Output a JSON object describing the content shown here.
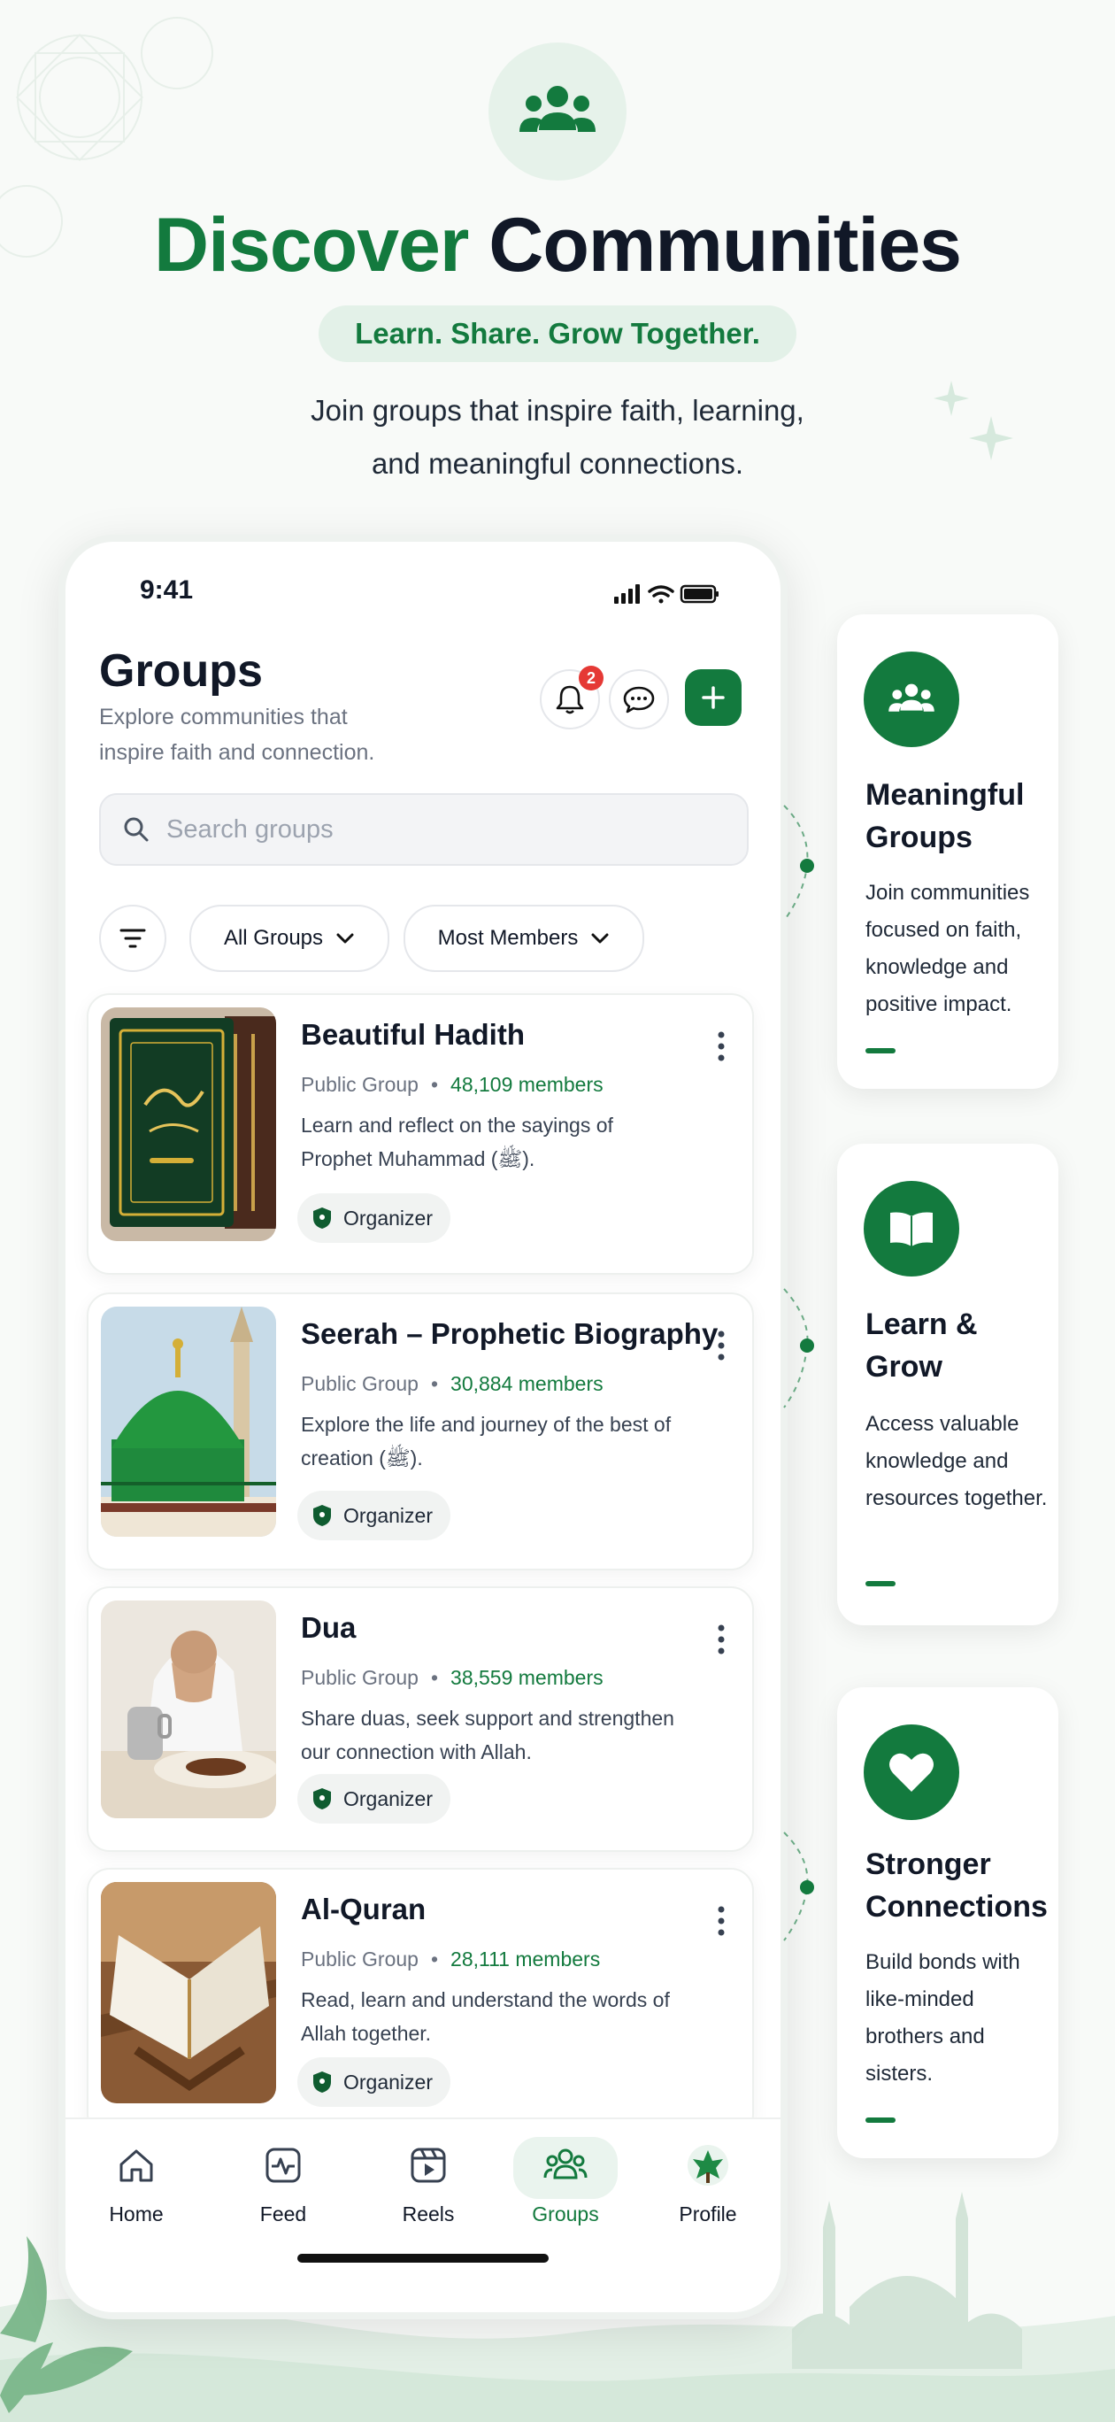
{
  "hero": {
    "title_green": "Discover",
    "title_dark": "Communities",
    "tagline": "Learn. Share. Grow Together.",
    "subtitle_line1": "Join groups that inspire faith, learning,",
    "subtitle_line2": "and meaningful connections."
  },
  "status_bar": {
    "time": "9:41"
  },
  "screen": {
    "title": "Groups",
    "description": "Explore communities that inspire faith and connection.",
    "notification_count": "2",
    "search_placeholder": "Search groups",
    "filters": {
      "group_type": "All Groups",
      "sort": "Most Members"
    }
  },
  "groups": [
    {
      "name": "Beautiful Hadith",
      "type": "Public Group",
      "members": "48,109 members",
      "description": "Learn and reflect on the sayings of Prophet Muhammad (ﷺ).",
      "role": "Organizer"
    },
    {
      "name": "Seerah – Prophetic Biography",
      "type": "Public Group",
      "members": "30,884 members",
      "description": "Explore the life and journey of the best of creation (ﷺ).",
      "role": "Organizer"
    },
    {
      "name": "Dua",
      "type": "Public Group",
      "members": "38,559 members",
      "description": "Share duas, seek support and strengthen our connection with Allah.",
      "role": "Organizer"
    },
    {
      "name": "Al-Quran",
      "type": "Public Group",
      "members": "28,111 members",
      "description": "Read, learn and understand the words of Allah together.",
      "role": "Organizer"
    }
  ],
  "nav": {
    "items": [
      {
        "label": "Home",
        "icon": "home-icon"
      },
      {
        "label": "Feed",
        "icon": "pulse-icon"
      },
      {
        "label": "Reels",
        "icon": "video-icon"
      },
      {
        "label": "Groups",
        "icon": "users-icon",
        "active": true
      },
      {
        "label": "Profile",
        "icon": "avatar-icon"
      }
    ]
  },
  "features": [
    {
      "title": "Meaningful Groups",
      "text": "Join communities focused on faith, knowledge and positive impact.",
      "icon": "users-icon"
    },
    {
      "title": "Learn & Grow",
      "text": "Access valuable knowledge and resources together.",
      "icon": "book-icon"
    },
    {
      "title": "Stronger Connections",
      "text": "Build bonds with like-minded brothers and sisters.",
      "icon": "heart-icon"
    }
  ],
  "colors": {
    "primary": "#137a3e",
    "tint": "#e3f1e8",
    "badge": "#e53935"
  }
}
